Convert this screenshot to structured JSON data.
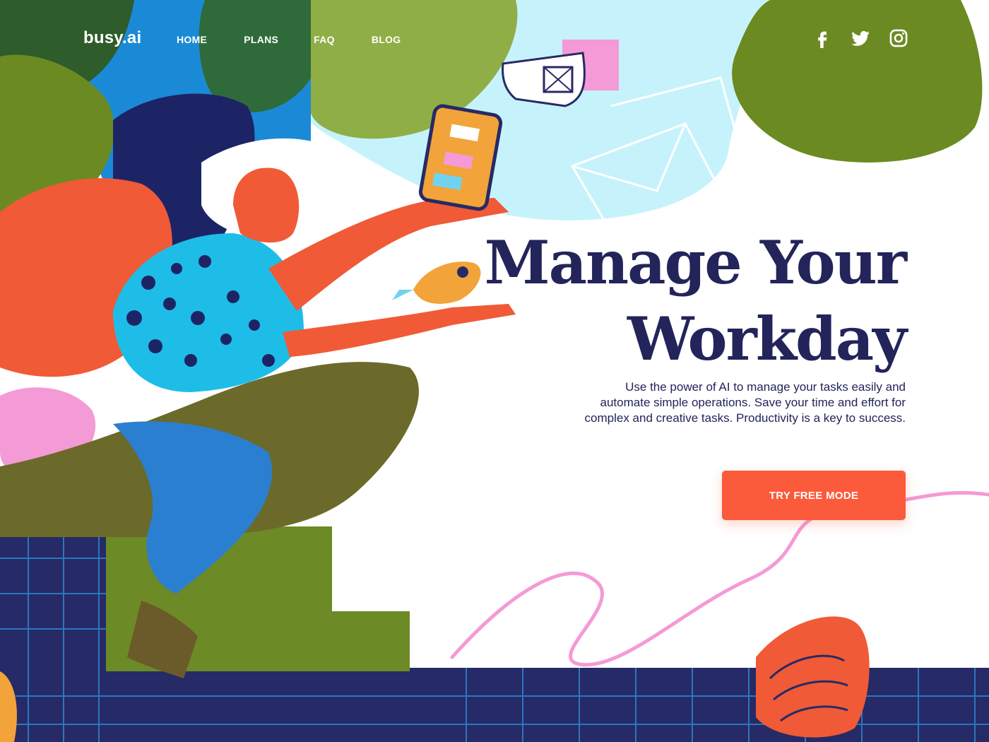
{
  "brand": {
    "name": "busy.ai"
  },
  "nav": {
    "items": [
      {
        "label": "HOME"
      },
      {
        "label": "PLANS"
      },
      {
        "label": "FAQ"
      },
      {
        "label": "BLOG"
      }
    ]
  },
  "social": {
    "icons": [
      "facebook-icon",
      "twitter-icon",
      "instagram-icon"
    ]
  },
  "hero": {
    "title_line1": "Manage Your",
    "title_line2": "Workday",
    "description": "Use the power of AI to manage your tasks easily and automate simple operations. Save your time and effort for complex and creative tasks. Productivity is a key to success.",
    "cta_label": "TRY FREE MODE"
  },
  "colors": {
    "navy": "#23245a",
    "accent": "#fb5a3b",
    "olive": "#6b8a22",
    "sky": "#c6f3fb",
    "pink": "#f49ad6",
    "blue": "#1b8ad6"
  }
}
